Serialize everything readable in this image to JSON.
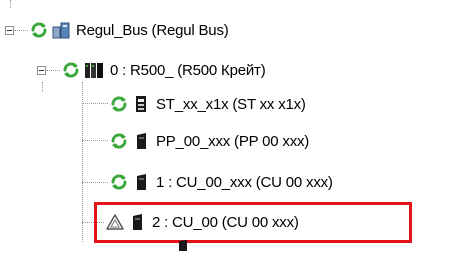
{
  "tree": {
    "items": [
      {
        "label": "Regul_Bus (Regul Bus)"
      },
      {
        "label": "0 : R500_ (R500 Крейт)"
      },
      {
        "label": "ST_xx_x1x (ST xx x1x)"
      },
      {
        "label": "PP_00_xxx (PP 00 xxx)"
      },
      {
        "label": "1 : CU_00_xxx (CU 00 xxx)"
      },
      {
        "label": "2 : CU_00 (CU 00 xxx)"
      }
    ]
  },
  "colors": {
    "highlight": "#e2141a",
    "sync_icon": "#3aa83a",
    "warning_icon": "#555555",
    "device_icon": "#1a1a1a"
  },
  "icons": {
    "sync": "sync-arrows-icon",
    "bus": "bus-icon",
    "crate": "crate-icon",
    "module": "module-icon",
    "warning": "warning-triangle-icon"
  }
}
